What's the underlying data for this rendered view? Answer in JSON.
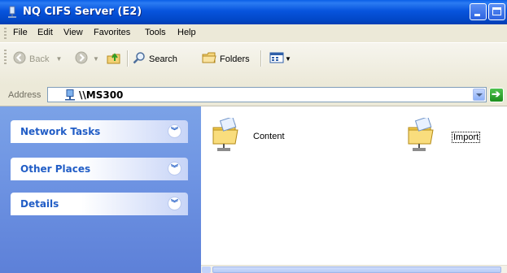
{
  "window": {
    "title": "NQ CIFS Server (E2)"
  },
  "menu": [
    "File",
    "Edit",
    "View",
    "Favorites",
    "Tools",
    "Help"
  ],
  "toolbar": {
    "back": "Back",
    "search": "Search",
    "folders": "Folders"
  },
  "address": {
    "label": "Address",
    "value": "\\\\MS300"
  },
  "tasks": {
    "network": "Network Tasks",
    "other": "Other Places",
    "details": "Details"
  },
  "items": [
    {
      "label": "Content",
      "icon": "network-share-folder-icon"
    },
    {
      "label": "Import",
      "icon": "network-share-folder-icon"
    }
  ],
  "colors": {
    "title_bar": "#0754dd",
    "task_pane": "#6f95e3",
    "task_title": "#215dc6"
  }
}
